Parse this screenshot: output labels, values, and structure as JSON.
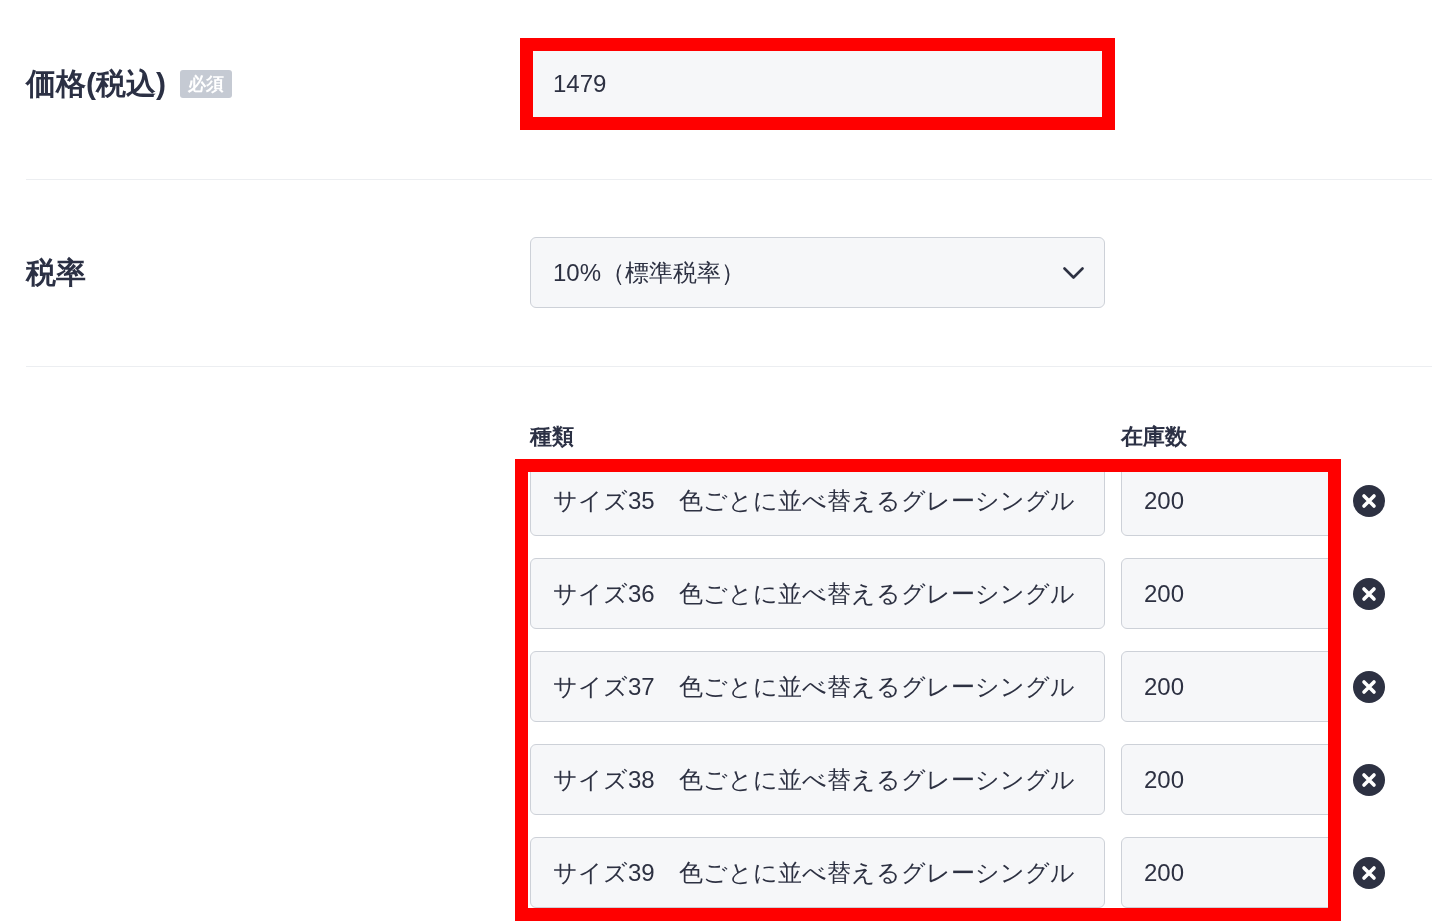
{
  "fields": [
    {
      "kind": "text",
      "label": "価格(税込)",
      "badge": "必須",
      "value": "1479",
      "highlighted": true
    },
    {
      "kind": "select",
      "label": "税率",
      "value": "10%（標準税率）",
      "highlighted": false
    }
  ],
  "variants": {
    "columns": [
      "種類",
      "在庫数"
    ],
    "highlighted": true,
    "rows": [
      {
        "name": "サイズ35　色ごとに並べ替えるグレーシングル",
        "stock": "200"
      },
      {
        "name": "サイズ36　色ごとに並べ替えるグレーシングル",
        "stock": "200"
      },
      {
        "name": "サイズ37　色ごとに並べ替えるグレーシングル",
        "stock": "200"
      },
      {
        "name": "サイズ38　色ごとに並べ替えるグレーシングル",
        "stock": "200"
      },
      {
        "name": "サイズ39　色ごとに並べ替えるグレーシングル",
        "stock": "200"
      }
    ]
  }
}
